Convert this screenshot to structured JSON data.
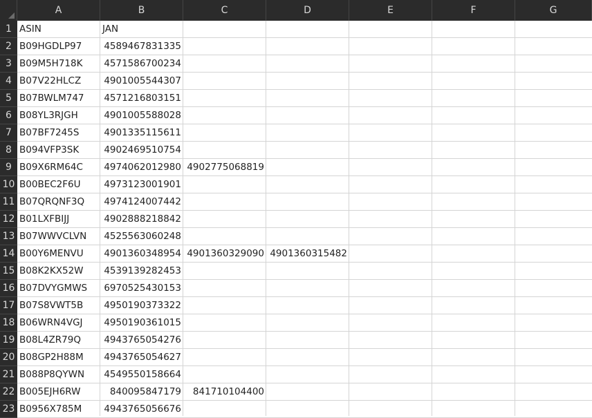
{
  "sheet": {
    "columns": [
      "A",
      "B",
      "C",
      "D",
      "E",
      "F",
      "G"
    ],
    "rows": [
      {
        "n": "1",
        "a": "ASIN",
        "b": "JAN",
        "c": "",
        "d": ""
      },
      {
        "n": "2",
        "a": "B09HGDLP97",
        "b": "4589467831335",
        "c": "",
        "d": ""
      },
      {
        "n": "3",
        "a": "B09M5H718K",
        "b": "4571586700234",
        "c": "",
        "d": ""
      },
      {
        "n": "4",
        "a": "B07V22HLCZ",
        "b": "4901005544307",
        "c": "",
        "d": ""
      },
      {
        "n": "5",
        "a": "B07BWLM747",
        "b": "4571216803151",
        "c": "",
        "d": ""
      },
      {
        "n": "6",
        "a": "B08YL3RJGH",
        "b": "4901005588028",
        "c": "",
        "d": ""
      },
      {
        "n": "7",
        "a": "B07BF7245S",
        "b": "4901335115611",
        "c": "",
        "d": ""
      },
      {
        "n": "8",
        "a": "B094VFP3SK",
        "b": "4902469510754",
        "c": "",
        "d": ""
      },
      {
        "n": "9",
        "a": "B09X6RM64C",
        "b": "4974062012980",
        "c": "4902775068819",
        "d": ""
      },
      {
        "n": "10",
        "a": "B00BEC2F6U",
        "b": "4973123001901",
        "c": "",
        "d": ""
      },
      {
        "n": "11",
        "a": "B07QRQNF3Q",
        "b": "4974124007442",
        "c": "",
        "d": ""
      },
      {
        "n": "12",
        "a": "B01LXFBIJJ",
        "b": "4902888218842",
        "c": "",
        "d": ""
      },
      {
        "n": "13",
        "a": "B07WWVCLVN",
        "b": "4525563060248",
        "c": "",
        "d": ""
      },
      {
        "n": "14",
        "a": "B00Y6MENVU",
        "b": "4901360348954",
        "c": "4901360329090",
        "d": "4901360315482"
      },
      {
        "n": "15",
        "a": "B08K2KX52W",
        "b": "4539139282453",
        "c": "",
        "d": ""
      },
      {
        "n": "16",
        "a": "B07DVYGMWS",
        "b": "6970525430153",
        "c": "",
        "d": ""
      },
      {
        "n": "17",
        "a": "B07S8VWT5B",
        "b": "4950190373322",
        "c": "",
        "d": ""
      },
      {
        "n": "18",
        "a": "B06WRN4VGJ",
        "b": "4950190361015",
        "c": "",
        "d": ""
      },
      {
        "n": "19",
        "a": "B08L4ZR79Q",
        "b": "4943765054276",
        "c": "",
        "d": ""
      },
      {
        "n": "20",
        "a": "B08GP2H88M",
        "b": "4943765054627",
        "c": "",
        "d": ""
      },
      {
        "n": "21",
        "a": "B088P8QYWN",
        "b": "4549550158664",
        "c": "",
        "d": ""
      },
      {
        "n": "22",
        "a": "B005EJH6RW",
        "b": "840095847179",
        "c": "841710104400",
        "d": ""
      },
      {
        "n": "23",
        "a": "B0956X785M",
        "b": "4943765056676",
        "c": "",
        "d": ""
      }
    ]
  },
  "colors": {
    "header_bg": "#2b2b2b",
    "header_text": "#d8d8d8",
    "grid": "#d4d4d4"
  }
}
